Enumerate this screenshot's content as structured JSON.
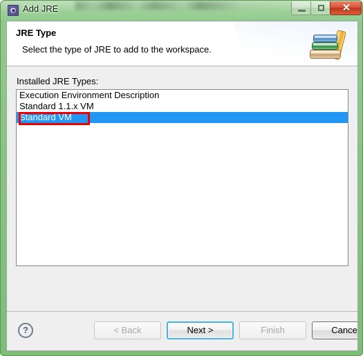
{
  "window": {
    "title": "Add JRE",
    "icon": "jre-gear-icon",
    "frame_color": "#86c47f",
    "controls": {
      "minimize": "–",
      "maximize": "□",
      "close": "✕"
    }
  },
  "banner": {
    "title": "JRE Type",
    "subtitle": "Select the type of JRE to add to the workspace.",
    "icon": "books-stack-icon"
  },
  "main": {
    "list_label": "Installed JRE Types:",
    "list_items": [
      {
        "label": "Execution Environment Description",
        "selected": false
      },
      {
        "label": "Standard 1.1.x VM",
        "selected": false
      },
      {
        "label": "Standard VM",
        "selected": true
      }
    ],
    "selection_color": "#2196f3",
    "annotation_color": "#ee0000"
  },
  "footer": {
    "help_label": "?",
    "buttons": [
      {
        "label": "< Back",
        "state": "disabled"
      },
      {
        "label": "Next >",
        "state": "default"
      },
      {
        "label": "Finish",
        "state": "disabled"
      },
      {
        "label": "Cancel",
        "state": "enabled"
      }
    ]
  }
}
